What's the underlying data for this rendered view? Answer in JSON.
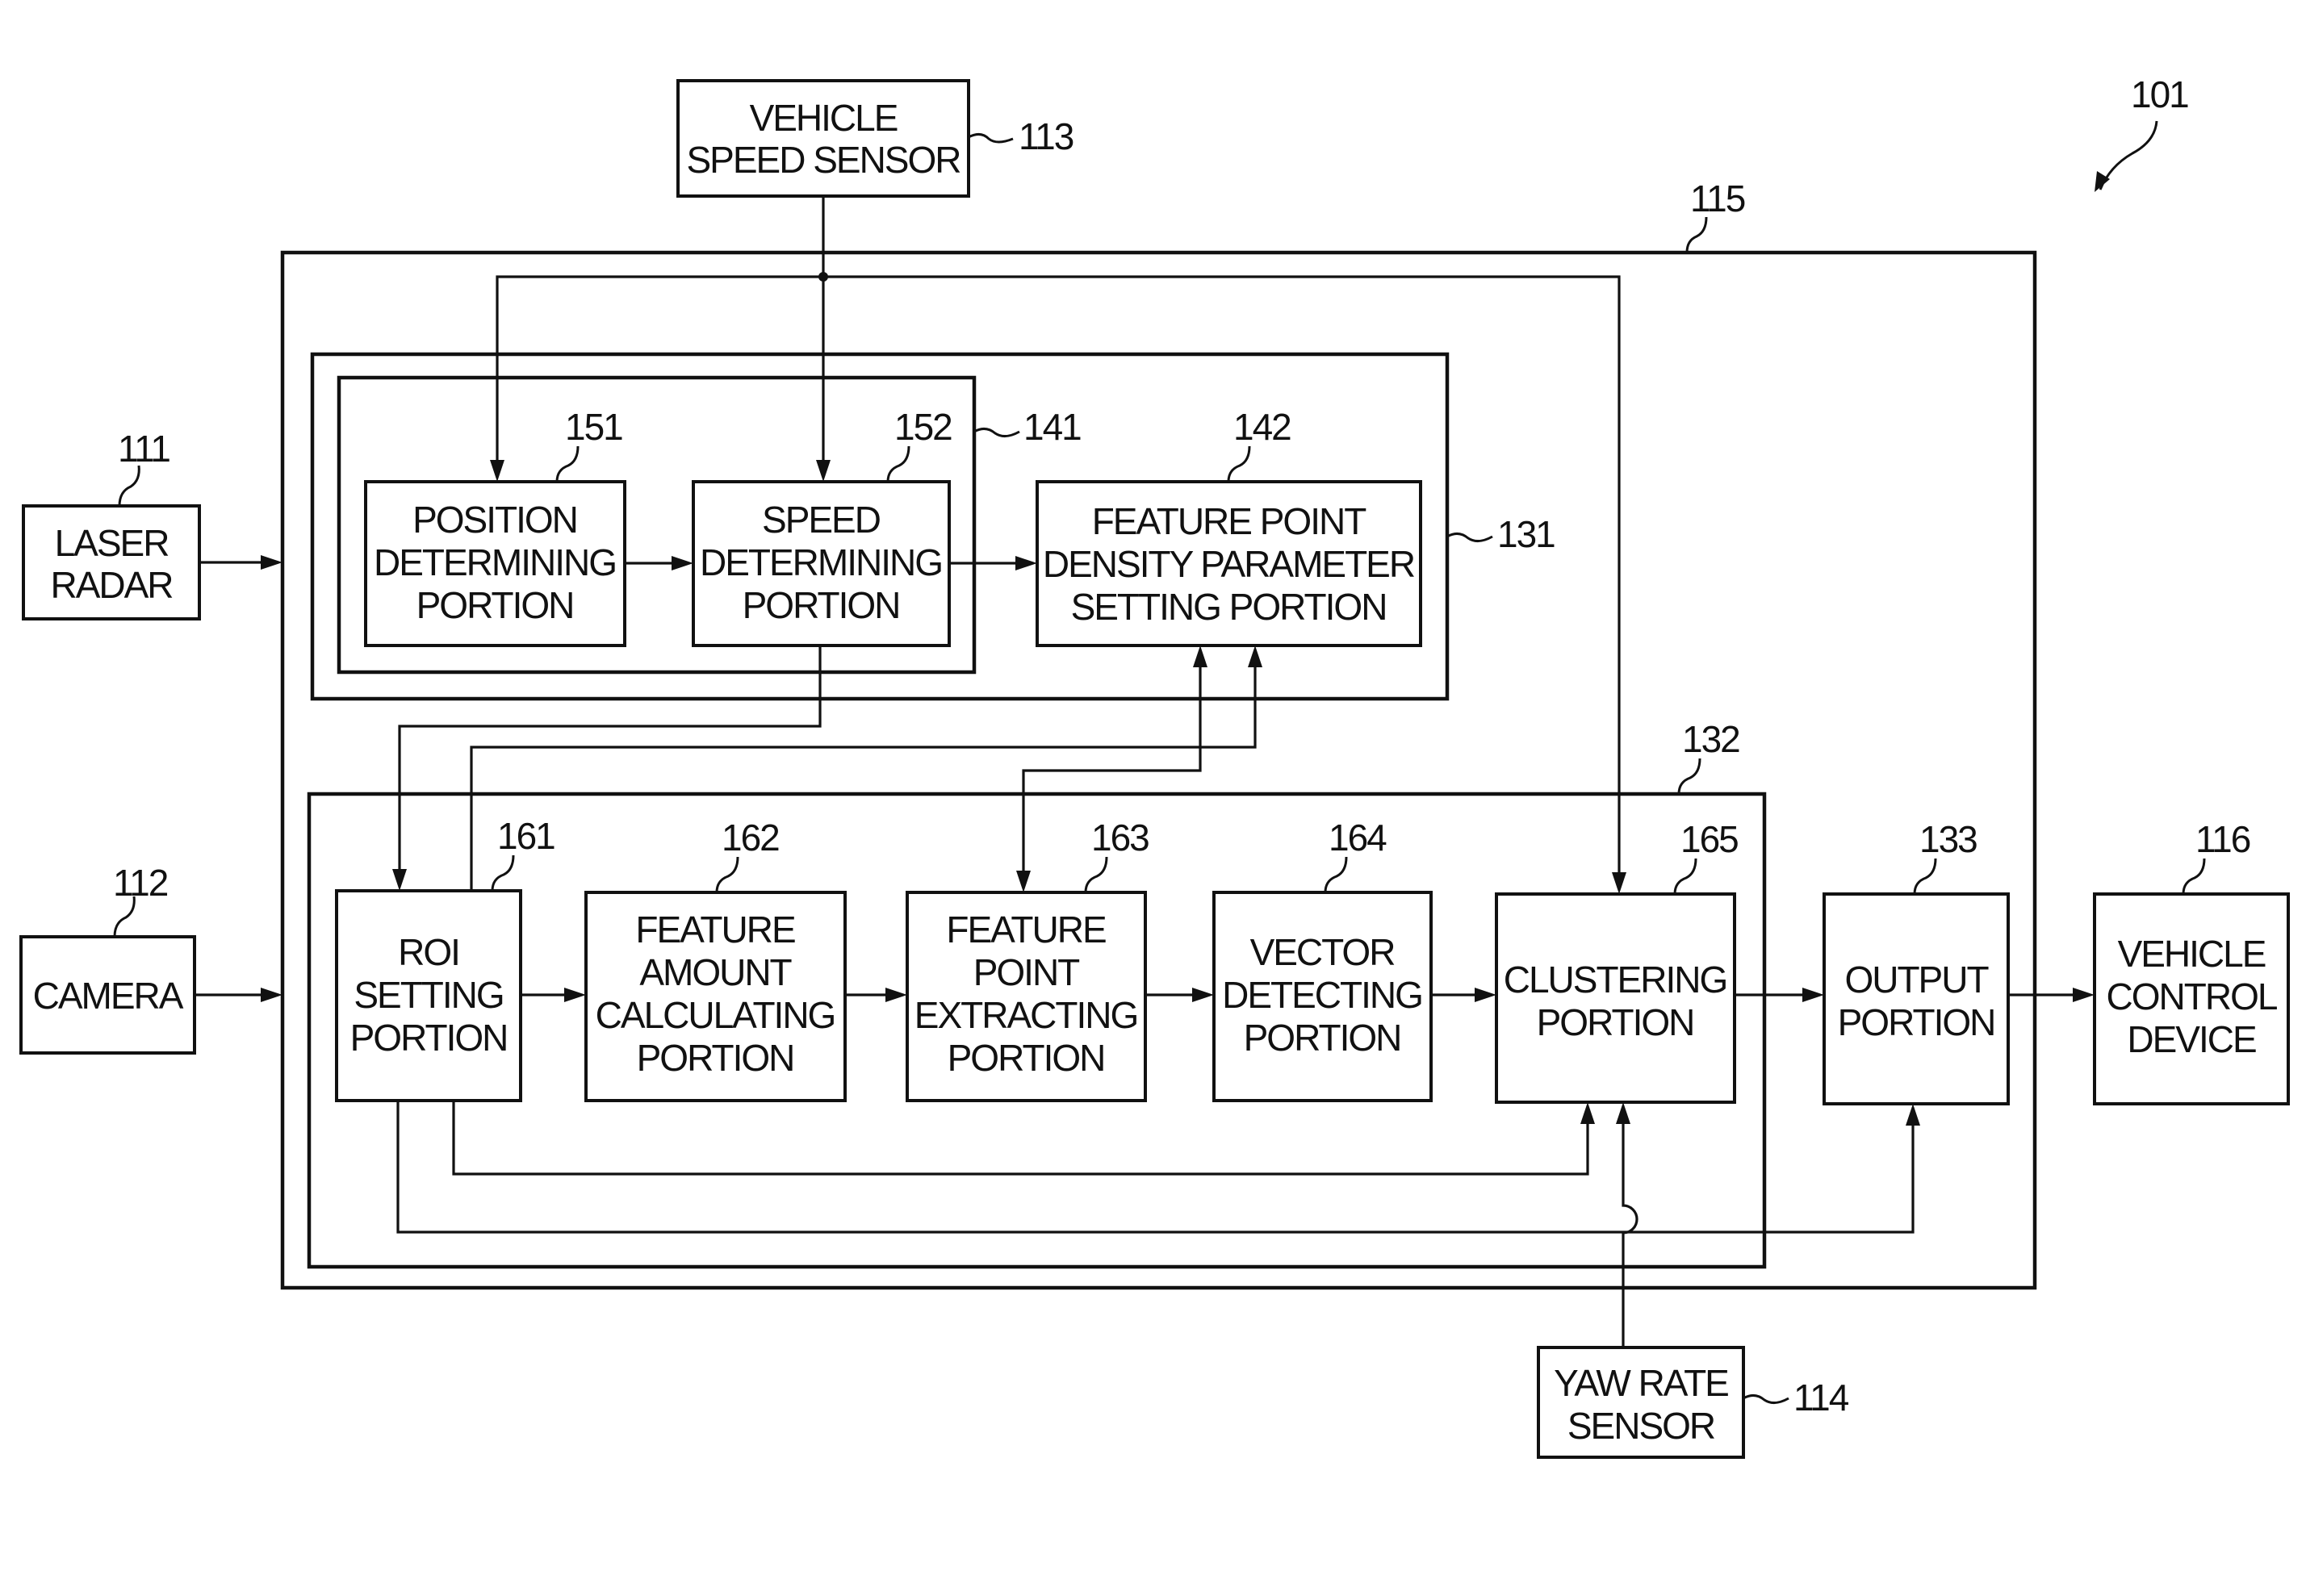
{
  "figure": {
    "reference": "101",
    "system_ref": "115"
  },
  "blocks": {
    "vehicle_speed_sensor": {
      "ref": "113",
      "lines": [
        "VEHICLE",
        "SPEED SENSOR"
      ]
    },
    "laser_radar": {
      "ref": "111",
      "lines": [
        "LASER",
        "RADAR"
      ]
    },
    "camera": {
      "ref": "112",
      "lines": [
        "CAMERA"
      ]
    },
    "yaw_rate_sensor": {
      "ref": "114",
      "lines": [
        "YAW RATE",
        "SENSOR"
      ]
    },
    "vehicle_control_device": {
      "ref": "116",
      "lines": [
        "VEHICLE",
        "CONTROL",
        "DEVICE"
      ]
    },
    "group_131": {
      "ref": "131"
    },
    "group_141": {
      "ref": "141"
    },
    "group_132": {
      "ref": "132"
    },
    "position_determining": {
      "ref": "151",
      "lines": [
        "POSITION",
        "DETERMINING",
        "PORTION"
      ]
    },
    "speed_determining": {
      "ref": "152",
      "lines": [
        "SPEED",
        "DETERMINING",
        "PORTION"
      ]
    },
    "density_parameter_setting": {
      "ref": "142",
      "lines": [
        "FEATURE POINT",
        "DENSITY PARAMETER",
        "SETTING PORTION"
      ]
    },
    "roi_setting": {
      "ref": "161",
      "lines": [
        "ROI",
        "SETTING",
        "PORTION"
      ]
    },
    "feature_amount_calculating": {
      "ref": "162",
      "lines": [
        "FEATURE",
        "AMOUNT",
        "CALCULATING",
        "PORTION"
      ]
    },
    "feature_point_extracting": {
      "ref": "163",
      "lines": [
        "FEATURE",
        "POINT",
        "EXTRACTING",
        "PORTION"
      ]
    },
    "vector_detecting": {
      "ref": "164",
      "lines": [
        "VECTOR",
        "DETECTING",
        "PORTION"
      ]
    },
    "clustering": {
      "ref": "165",
      "lines": [
        "CLUSTERING",
        "PORTION"
      ]
    },
    "output": {
      "ref": "133",
      "lines": [
        "OUTPUT",
        "PORTION"
      ]
    }
  },
  "connections": [
    {
      "from": "vehicle_speed_sensor",
      "to": "position_determining"
    },
    {
      "from": "vehicle_speed_sensor",
      "to": "speed_determining"
    },
    {
      "from": "vehicle_speed_sensor",
      "to": "clustering"
    },
    {
      "from": "laser_radar",
      "to": "system_115"
    },
    {
      "from": "camera",
      "to": "system_115"
    },
    {
      "from": "position_determining",
      "to": "speed_determining"
    },
    {
      "from": "speed_determining",
      "to": "density_parameter_setting"
    },
    {
      "from": "speed_determining",
      "to": "roi_setting"
    },
    {
      "from": "roi_setting",
      "to": "density_parameter_setting"
    },
    {
      "from": "density_parameter_setting",
      "to": "feature_point_extracting"
    },
    {
      "from": "roi_setting",
      "to": "feature_amount_calculating"
    },
    {
      "from": "feature_amount_calculating",
      "to": "feature_point_extracting"
    },
    {
      "from": "feature_point_extracting",
      "to": "vector_detecting"
    },
    {
      "from": "vector_detecting",
      "to": "clustering"
    },
    {
      "from": "roi_setting",
      "to": "clustering"
    },
    {
      "from": "roi_setting",
      "to": "output"
    },
    {
      "from": "yaw_rate_sensor",
      "to": "clustering"
    },
    {
      "from": "clustering",
      "to": "output"
    },
    {
      "from": "output",
      "to": "vehicle_control_device"
    }
  ]
}
